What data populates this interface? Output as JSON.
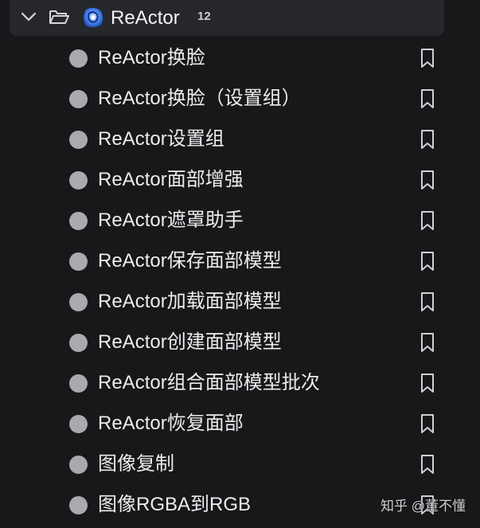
{
  "group": {
    "title": "ReActor",
    "count": "12",
    "expand_icon": "chevron-down-icon",
    "folder_icon": "folder-open-icon",
    "logo_icon": "reactor-logo-icon"
  },
  "nodes": [
    {
      "label": "ReActor换脸"
    },
    {
      "label": "ReActor换脸（设置组）"
    },
    {
      "label": "ReActor设置组"
    },
    {
      "label": "ReActor面部增强"
    },
    {
      "label": "ReActor遮罩助手"
    },
    {
      "label": "ReActor保存面部模型"
    },
    {
      "label": "ReActor加载面部模型"
    },
    {
      "label": "ReActor创建面部模型"
    },
    {
      "label": "ReActor组合面部模型批次"
    },
    {
      "label": "ReActor恢复面部"
    },
    {
      "label": "图像复制"
    },
    {
      "label": "图像RGBA到RGB"
    }
  ],
  "watermark": "知乎 @董不懂",
  "colors": {
    "background": "#18181b",
    "header": "#26272b",
    "dot": "#a9a9ae",
    "logo_blue": "#2f6fe8"
  }
}
